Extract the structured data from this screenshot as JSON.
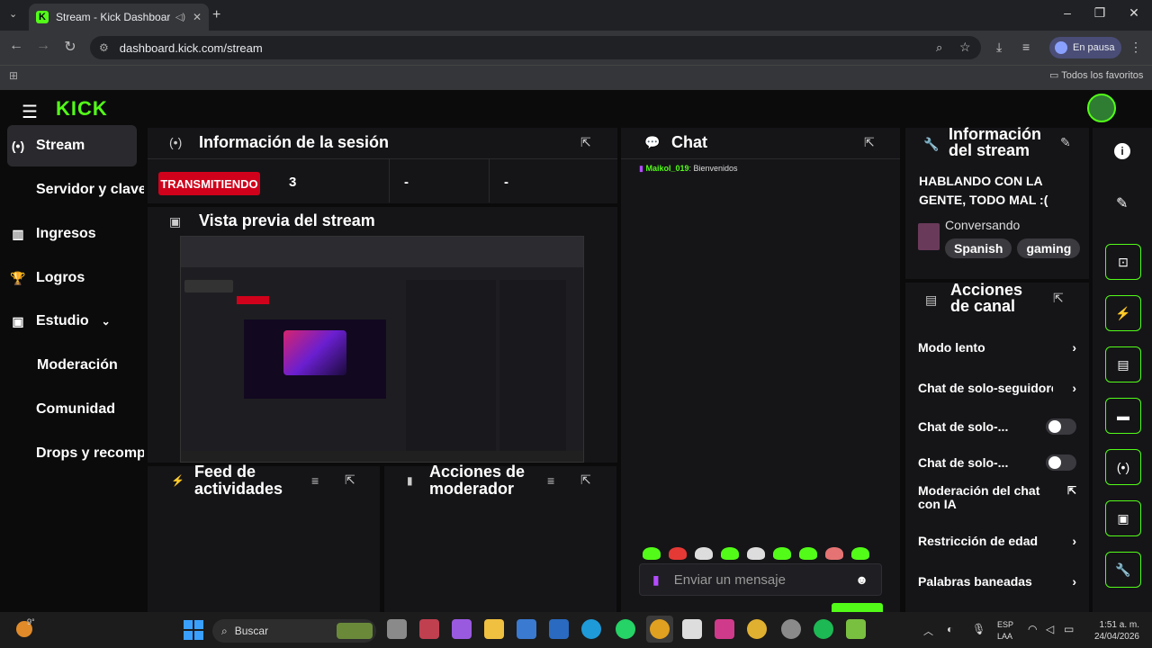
{
  "browser": {
    "tab_title": "Stream - Kick Dashboard",
    "url": "dashboard.kick.com/stream",
    "profile_label": "En pausa",
    "bookmarks_label": "Todos los favoritos"
  },
  "sidebar": {
    "items": [
      {
        "label": "Stream"
      },
      {
        "label": "Servidor y clave"
      },
      {
        "label": "Ingresos"
      },
      {
        "label": "Logros"
      },
      {
        "label": "Estudio"
      },
      {
        "label": "Moderación"
      },
      {
        "label": "Comunidad"
      },
      {
        "label": "Drops y recompensas"
      }
    ]
  },
  "session": {
    "title": "Información de la sesión",
    "status": "TRANSMITIENDO",
    "viewers": "3",
    "stat2": "-",
    "stat3": "-"
  },
  "preview": {
    "title": "Vista previa del stream"
  },
  "feed": {
    "title_line1": "Feed de",
    "title_line2": "actividades"
  },
  "modactions": {
    "title_line1": "Acciones de",
    "title_line2": "moderador"
  },
  "chat": {
    "title": "Chat",
    "messages": [
      {
        "user": "Maikol_019",
        "text": "Bienvenidos"
      }
    ],
    "input_placeholder": "Enviar un mensaje"
  },
  "stream_info": {
    "title_line1": "Información",
    "title_line2": "del stream",
    "stream_title_line1": "HABLANDO CON LA",
    "stream_title_line2": "GENTE, TODO MAL :(",
    "category": "Conversando",
    "tags": [
      "Spanish",
      "gaming"
    ]
  },
  "channel_actions": {
    "title_line1": "Acciones",
    "title_line2": "de canal",
    "rows": [
      {
        "label": "Modo lento"
      },
      {
        "label": "Chat de solo-seguidores"
      },
      {
        "label": "Chat de solo-..."
      },
      {
        "label": "Chat de solo-..."
      },
      {
        "label_line1": "Moderación del chat",
        "label_line2": "con IA"
      },
      {
        "label": "Restricción de edad"
      },
      {
        "label": "Palabras baneadas"
      }
    ]
  },
  "taskbar": {
    "weather": "9°",
    "search_placeholder": "Buscar",
    "lang_line1": "ESP",
    "lang_line2": "LAA",
    "time": "1:51 a. m.",
    "date": "24/04/2026"
  },
  "colors": {
    "accent": "#53fc18",
    "live": "#d0021b"
  }
}
